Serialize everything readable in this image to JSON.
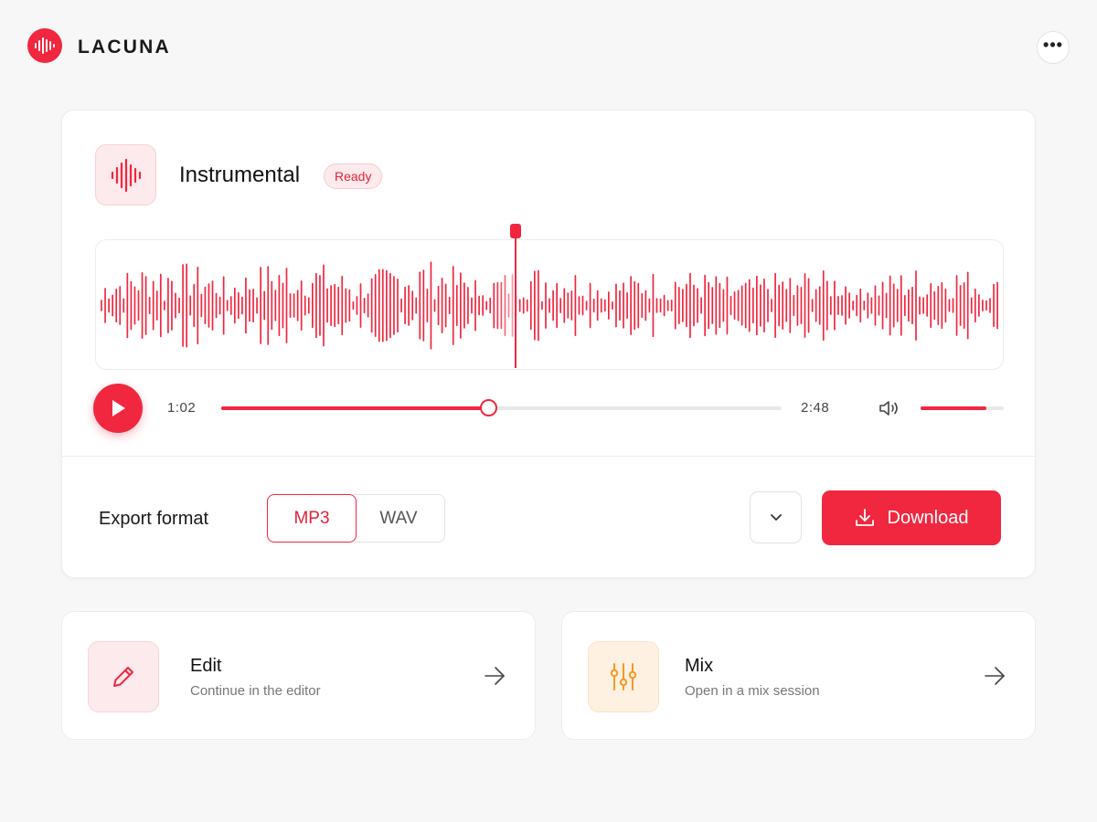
{
  "app": {
    "brand": "LACUNA",
    "accent": "#f1273f"
  },
  "header": {
    "more_icon": "more-horizontal-icon"
  },
  "track": {
    "title": "Instrumental",
    "status": "Ready",
    "icon": "waveform-icon"
  },
  "player": {
    "current_time": "1:02",
    "total_time": "2:48",
    "progress_fraction": 0.477,
    "volume_fraction": 0.79,
    "play_icon": "play-icon",
    "volume_icon": "volume-icon"
  },
  "export": {
    "label": "Export format",
    "options": [
      "MP3",
      "WAV"
    ],
    "selected": "MP3",
    "dropdown_icon": "chevron-down-icon",
    "download_label": "Download",
    "download_icon": "download-icon"
  },
  "actions": [
    {
      "title": "Edit",
      "subtitle": "Continue in the editor",
      "icon": "pencil-icon",
      "icon_color": "#f1273f"
    },
    {
      "title": "Mix",
      "subtitle": "Open in a mix session",
      "icon": "sliders-icon",
      "icon_color": "#f59a23"
    }
  ]
}
